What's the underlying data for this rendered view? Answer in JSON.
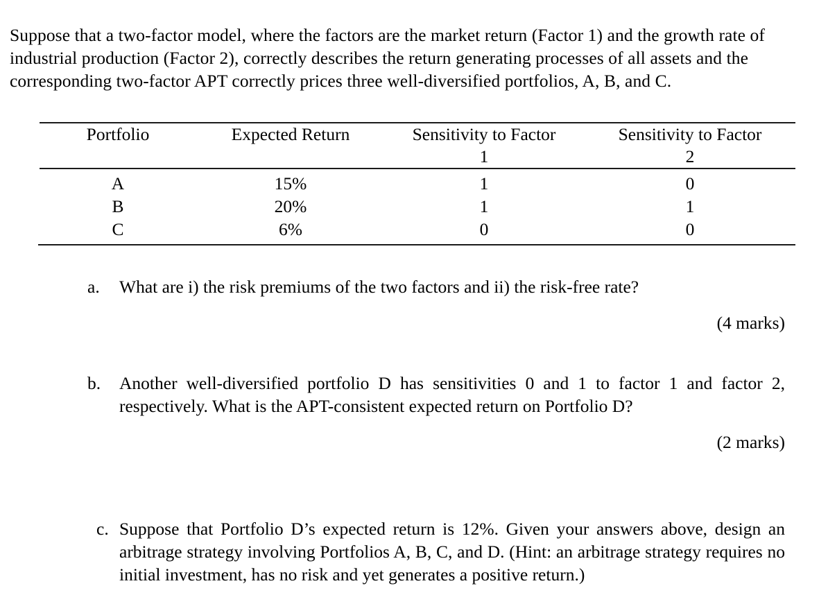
{
  "document": {
    "intro_paragraph": "Suppose that a two-factor model, where the factors are the market return (Factor 1) and the growth rate of industrial production (Factor 2), correctly describes the return generating processes of all assets and the corresponding two-factor APT correctly prices three well-diversified portfolios, A, B, and C."
  },
  "table": {
    "headers": [
      {
        "line1": "Portfolio",
        "line2": ""
      },
      {
        "line1": "Expected Return",
        "line2": ""
      },
      {
        "line1": "Sensitivity to Factor",
        "line2": "1"
      },
      {
        "line1": "Sensitivity to Factor",
        "line2": "2"
      }
    ],
    "rows": [
      {
        "portfolio": "A",
        "expected_return": "15%",
        "sensitivity_factor_1": "1",
        "sensitivity_factor_2": "0"
      },
      {
        "portfolio": "B",
        "expected_return": "20%",
        "sensitivity_factor_1": "1",
        "sensitivity_factor_2": "1"
      },
      {
        "portfolio": "C",
        "expected_return": "6%",
        "sensitivity_factor_1": "0",
        "sensitivity_factor_2": "0"
      }
    ]
  },
  "questions": [
    {
      "marker": "a.",
      "text": "What are i) the risk premiums of the two factors and ii) the risk-free rate?",
      "marks": "(4 marks)"
    },
    {
      "marker": "b.",
      "text": "Another well-diversified portfolio D has sensitivities 0 and 1 to factor 1 and factor 2, respectively. What is the APT-consistent expected return on Portfolio D?",
      "marks": "(2 marks)"
    },
    {
      "marker": "c.",
      "text": "Suppose that Portfolio D’s expected return is 12%. Given your answers above, design an arbitrage strategy involving Portfolios A, B, C, and D. (Hint: an arbitrage strategy requires no initial investment, has no risk and yet generates a positive return.)",
      "marks": ""
    }
  ]
}
